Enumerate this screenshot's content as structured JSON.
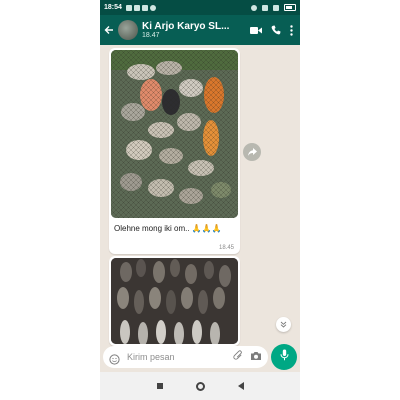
{
  "status_bar": {
    "time": "18:54"
  },
  "header": {
    "contact_name": "Ki Arjo Karyo SL...",
    "subtitle": "18.47"
  },
  "messages": [
    {
      "type": "image",
      "caption": "Olehne mong iki om.. 🙏🙏🙏",
      "time": "18.45"
    },
    {
      "type": "image",
      "caption": "",
      "time": ""
    }
  ],
  "composer": {
    "placeholder": "Kirim pesan"
  },
  "colors": {
    "header": "#075e54",
    "status_bar": "#054d44",
    "accent": "#00a884",
    "chat_background": "#ece5dd"
  },
  "icons": [
    "back-arrow-icon",
    "video-call-icon",
    "phone-icon",
    "more-options-icon",
    "share-forward-icon",
    "scroll-down-icon",
    "emoji-icon",
    "attach-icon",
    "camera-icon",
    "mic-icon"
  ]
}
